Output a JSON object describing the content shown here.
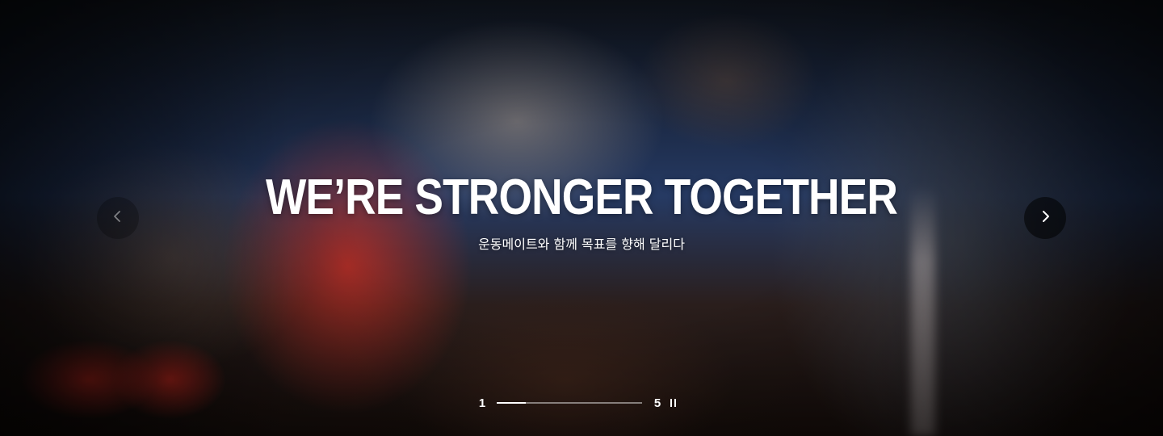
{
  "hero": {
    "title": "WE’RE STRONGER TOGETHER",
    "subtitle": "운동메이트와 함께 목표를 향해 달리다"
  },
  "carousel": {
    "current": "1",
    "total": "5",
    "progress": 0.2,
    "prev_icon": "chevron-left-icon",
    "next_icon": "chevron-right-icon",
    "pause_icon": "pause-icon"
  }
}
